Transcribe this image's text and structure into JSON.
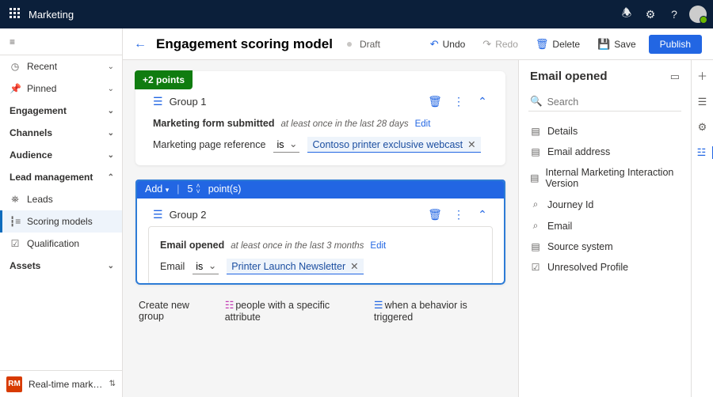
{
  "app": {
    "name": "Marketing"
  },
  "leftnav": {
    "recent": "Recent",
    "pinned": "Pinned",
    "sections": {
      "engagement": "Engagement",
      "channels": "Channels",
      "audience": "Audience",
      "lead": "Lead management",
      "assets": "Assets"
    },
    "lead_items": {
      "leads": "Leads",
      "scoring": "Scoring models",
      "qual": "Qualification"
    },
    "area": {
      "badge": "RM",
      "label": "Real-time marketi…"
    }
  },
  "cmdbar": {
    "title": "Engagement scoring model",
    "status": "Draft",
    "undo": "Undo",
    "redo": "Redo",
    "delete": "Delete",
    "save": "Save",
    "publish": "Publish"
  },
  "group1": {
    "badge": "+2 points",
    "name": "Group 1",
    "cond_title": "Marketing form submitted",
    "cond_freq": "at least once in the last 28 days",
    "edit": "Edit",
    "filter_field": "Marketing page reference",
    "filter_op": "is",
    "filter_value": "Contoso printer exclusive webcast"
  },
  "group2": {
    "strip_action": "Add",
    "strip_num": "5",
    "strip_unit": "point(s)",
    "name": "Group 2",
    "cond_title": "Email opened",
    "cond_freq": "at least once in the last 3 months",
    "edit": "Edit",
    "filter_field": "Email",
    "filter_op": "is",
    "filter_value": "Printer Launch Newsletter"
  },
  "createrow": {
    "lead": "Create new group",
    "attr": "people with a specific attribute",
    "behav": "when a behavior is triggered"
  },
  "rightpanel": {
    "title": "Email opened",
    "search_placeholder": "Search",
    "items": {
      "details": "Details",
      "email_addr": "Email address",
      "version": "Internal Marketing Interaction Version",
      "journey": "Journey Id",
      "email": "Email",
      "source": "Source system",
      "profile": "Unresolved Profile"
    }
  }
}
